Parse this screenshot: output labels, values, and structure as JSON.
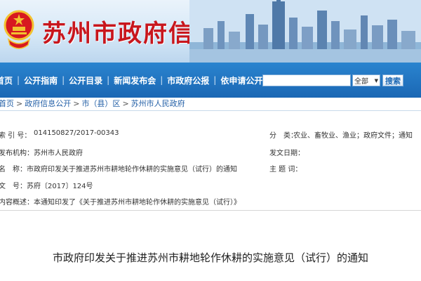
{
  "header": {
    "site_title": "苏州市政府信息公开",
    "colors": {
      "title_red": "#c8161d",
      "nav_blue": "#1b67b4",
      "link_blue": "#2460a7"
    }
  },
  "nav": {
    "items": [
      "首页",
      "公开指南",
      "公开目录",
      "新闻发布会",
      "市政府公报",
      "依申请公开"
    ],
    "search_scope": "全部",
    "search_button": "搜索",
    "search_placeholder": ""
  },
  "breadcrumb": [
    "首页",
    "政府信息公开",
    "市（县）区",
    "苏州市人民政府"
  ],
  "meta": {
    "index_label": "索 引 号：",
    "index_value": "014150827/2017-00343",
    "category_label": "分　类：",
    "category_value": "农业、畜牧业、渔业；政府文件；通知",
    "publisher_label": "发布机构：",
    "publisher_value": "苏州市人民政府",
    "date_label": "发文日期：",
    "date_value": "",
    "name_label": "名　称：",
    "name_value": "市政府印发关于推进苏州市耕地轮作休耕的实施意见（试行）的通知",
    "subject_label": "主 题 词：",
    "subject_value": "",
    "docno_label": "文　号：",
    "docno_value": "苏府〔2017〕124号",
    "summary_label": "内容概述：",
    "summary_value": "本通知印发了《关于推进苏州市耕地轮作休耕的实施意见（试行）》"
  },
  "document": {
    "title": "市政府印发关于推进苏州市耕地轮作休耕的实施意见（试行）的通知"
  }
}
